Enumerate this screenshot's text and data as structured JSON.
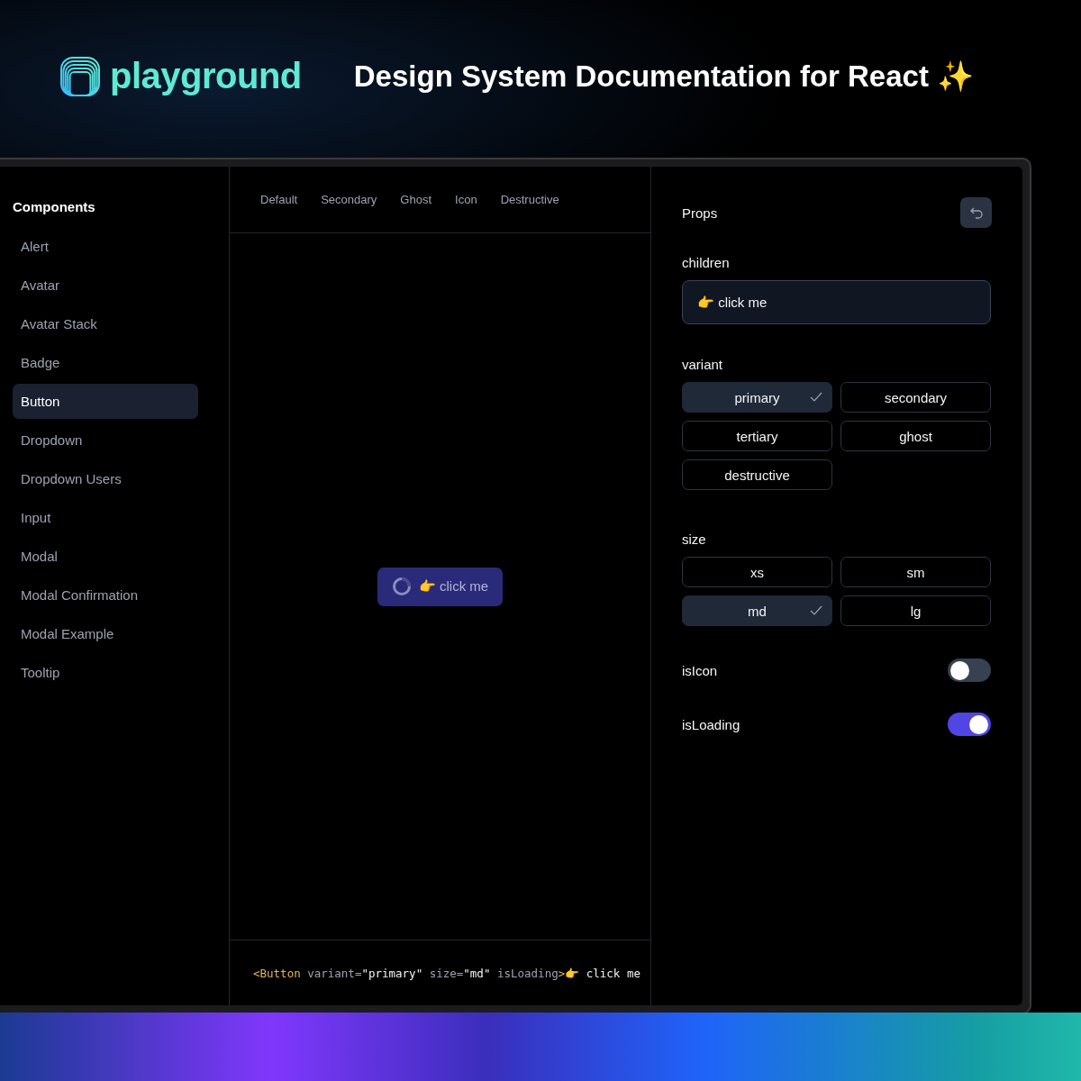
{
  "header": {
    "brand": "playground",
    "tagline": "Design System Documentation for React ✨"
  },
  "sidebar": {
    "title": "Components",
    "items": [
      {
        "label": "Alert",
        "selected": false
      },
      {
        "label": "Avatar",
        "selected": false
      },
      {
        "label": "Avatar Stack",
        "selected": false
      },
      {
        "label": "Badge",
        "selected": false
      },
      {
        "label": "Button",
        "selected": true
      },
      {
        "label": "Dropdown",
        "selected": false
      },
      {
        "label": "Dropdown Users",
        "selected": false
      },
      {
        "label": "Input",
        "selected": false
      },
      {
        "label": "Modal",
        "selected": false
      },
      {
        "label": "Modal Confirmation",
        "selected": false
      },
      {
        "label": "Modal Example",
        "selected": false
      },
      {
        "label": "Tooltip",
        "selected": false
      }
    ]
  },
  "preview": {
    "tabs": [
      "Default",
      "Secondary",
      "Ghost",
      "Icon",
      "Destructive"
    ],
    "button": {
      "label": "👉 click me",
      "loading": true
    },
    "code": [
      {
        "kind": "tag",
        "text": "<Button"
      },
      {
        "kind": "attr",
        "text": " variant="
      },
      {
        "kind": "string",
        "text": "\"primary\""
      },
      {
        "kind": "attr",
        "text": " size="
      },
      {
        "kind": "string",
        "text": "\"md\""
      },
      {
        "kind": "attr",
        "text": " isLoading"
      },
      {
        "kind": "tag",
        "text": ">"
      },
      {
        "kind": "child",
        "text": "👉 click me"
      }
    ]
  },
  "props": {
    "title": "Props",
    "children": {
      "label": "children",
      "value": "👉 click me"
    },
    "variant": {
      "label": "variant",
      "options": [
        {
          "label": "primary",
          "selected": true
        },
        {
          "label": "secondary",
          "selected": false
        },
        {
          "label": "tertiary",
          "selected": false
        },
        {
          "label": "ghost",
          "selected": false
        },
        {
          "label": "destructive",
          "selected": false
        }
      ]
    },
    "size": {
      "label": "size",
      "options": [
        {
          "label": "xs",
          "selected": false
        },
        {
          "label": "sm",
          "selected": false
        },
        {
          "label": "md",
          "selected": true
        },
        {
          "label": "lg",
          "selected": false
        }
      ]
    },
    "toggles": [
      {
        "label": "isIcon",
        "on": false
      },
      {
        "label": "isLoading",
        "on": true
      }
    ]
  }
}
